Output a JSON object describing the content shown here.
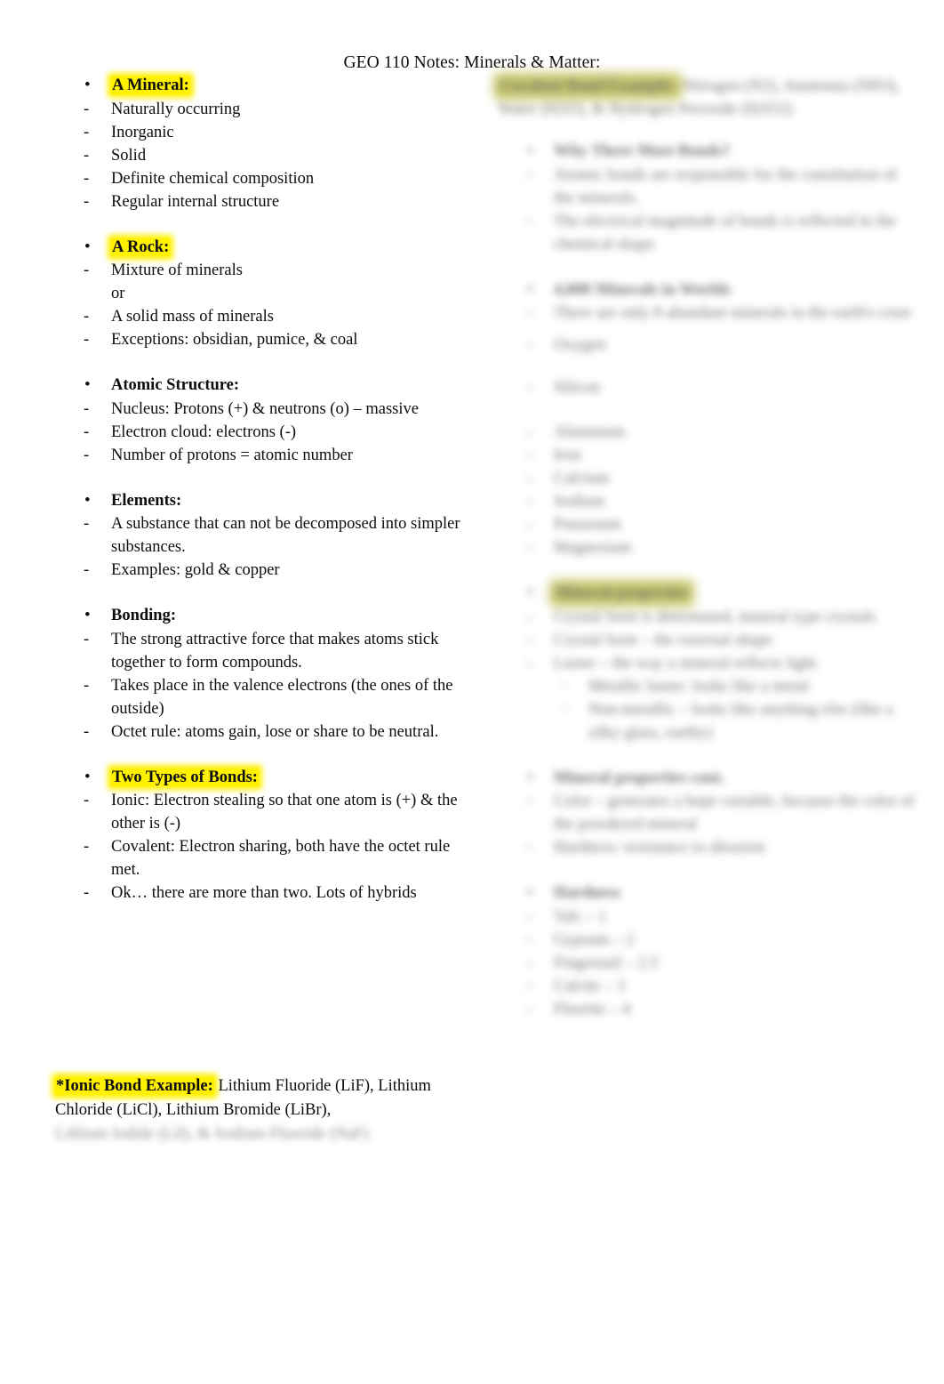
{
  "document": {
    "title": "GEO 110 Notes: Minerals & Matter:",
    "highlight_color": "#fff100",
    "page_background": "#ffffff",
    "text_color": "#0d0d0d"
  },
  "left_column": {
    "sections": [
      {
        "heading": "A Mineral:",
        "highlighted": true,
        "bullets": [
          "Naturally occurring",
          "Inorganic",
          "Solid",
          "Definite chemical composition",
          "Regular internal structure"
        ]
      },
      {
        "heading": "A Rock:",
        "highlighted": true,
        "bullets": [
          "Mixture of minerals",
          "or",
          "A solid mass of minerals",
          "Exceptions: obsidian, pumice, & coal"
        ]
      },
      {
        "heading": "Atomic Structure:",
        "highlighted": false,
        "bullets": [
          "Nucleus: Protons (+) & neutrons (o) – massive",
          "Electron cloud: electrons (-)",
          "Number of protons = atomic number"
        ]
      },
      {
        "heading": "Elements:",
        "highlighted": false,
        "bullets": [
          "A substance that can not be decomposed into simpler substances.",
          "Examples: gold & copper"
        ]
      },
      {
        "heading": "Bonding:",
        "highlighted": false,
        "bullets": [
          "The strong attractive force that makes atoms stick together to form compounds.",
          "Takes place in the valence electrons (the ones of the outside)",
          "Octet rule: atoms gain, lose or share to be neutral."
        ]
      },
      {
        "heading": "Two Types of Bonds:",
        "highlighted": true,
        "bullets": [
          "Ionic: Electron stealing so that one atom is (+) & the other is (-)",
          "Covalent: Electron sharing, both have the octet rule met.",
          "Ok… there are more than two. Lots of hybrids"
        ]
      }
    ],
    "footnote": {
      "label": "*Ionic Bond Example:",
      "label_highlighted": true,
      "body": " Lithium Fluoride (LiF), Lithium Chloride (LiCl), Lithium Bromide (LiBr),",
      "obscured_tail": "Lithium Iodide (LiI), & Sodium Fluoride (NaF)"
    }
  },
  "right_column": {
    "obscured": true,
    "note": "entire column is blurred / illegible in the source image",
    "lead_paragraph": {
      "highlighted_fragment": "Covalent Bond Example:",
      "rest": " Nitrogen (N2), Ammonia (NH3), Water (H2O), & Hydrogen Peroxide (H2O2)"
    },
    "sections": [
      {
        "heading": "Why There Must Bonds?",
        "bullets": [
          "Atomic bonds are responsible for the constitution of the minerals.",
          "The electrical magnitude of bonds is reflected in the chemical shape"
        ]
      },
      {
        "heading": "4,000 Minerals in Worlds",
        "bullets": [
          "There are only 8 abundant minerals in the earth's crust",
          "Oxygen",
          "Silicon",
          "Aluminum",
          "Iron",
          "Calcium",
          "Sodium",
          "Potassium",
          "Magnesium"
        ]
      },
      {
        "heading": "Mineral properties",
        "bullets": [
          "Crystal form is determined, mineral type crystals",
          "Crystal form – the external shape",
          "Luster – the way a mineral reflects light",
          "Metallic luster: looks like a metal",
          "Non-metallic – looks like anything else (like a silky glass, earthy)"
        ]
      },
      {
        "heading": "Mineral properties cont.",
        "bullets": [
          "Color – generates a hope variable, because the color of the powdered mineral",
          "Hardness: resistance to abrasion"
        ]
      },
      {
        "heading": "Hardness",
        "bullets": [
          "Talc – 1",
          "Gypsum – 2",
          "Fingernail – 2.5",
          "Calcite – 3",
          "Fluorite – 4"
        ]
      }
    ]
  }
}
